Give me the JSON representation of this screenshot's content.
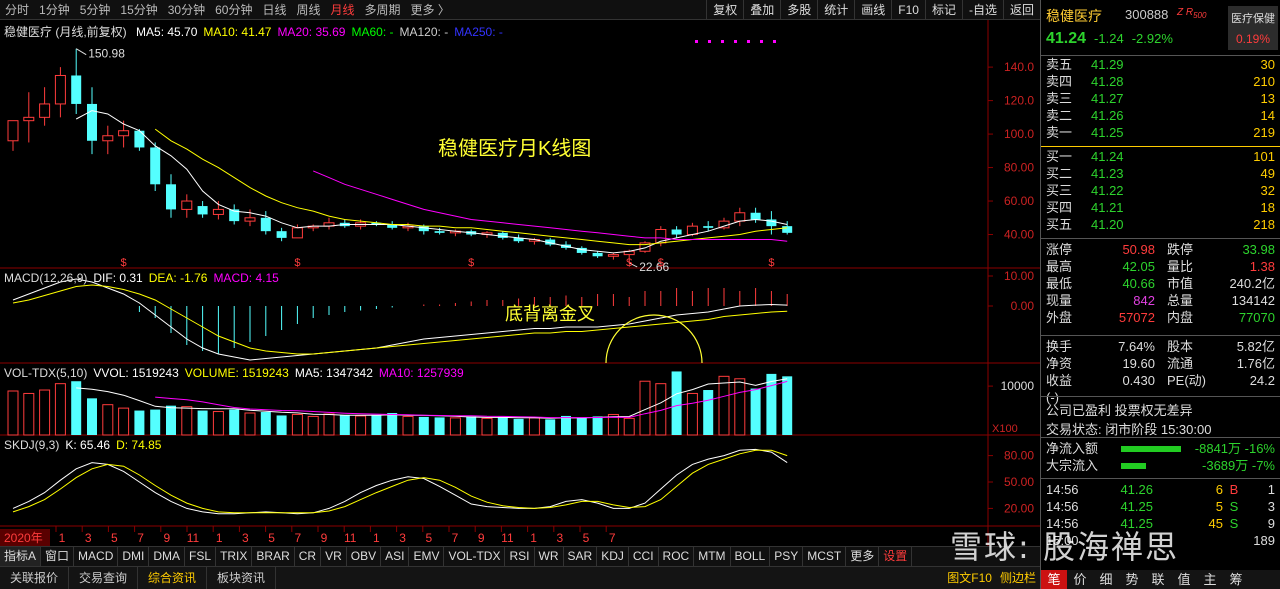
{
  "toolbar": {
    "periods": [
      "分时",
      "1分钟",
      "5分钟",
      "15分钟",
      "30分钟",
      "60分钟",
      "日线",
      "周线",
      "月线",
      "多周期",
      "更多 〉"
    ],
    "active_period": 8,
    "tools": [
      "复权",
      "叠加",
      "多股",
      "统计",
      "画线",
      "F10",
      "标记",
      "-自选",
      "返回"
    ]
  },
  "main_panel": {
    "legend": {
      "title": "稳健医疗 (月线,前复权)",
      "items": [
        {
          "text": "MA5: 45.70",
          "color": "#ffffff"
        },
        {
          "text": "MA10: 41.47",
          "color": "#ffff00"
        },
        {
          "text": "MA20: 35.69",
          "color": "#ff00ff"
        },
        {
          "text": "MA60: -",
          "color": "#00ff00"
        },
        {
          "text": "MA120: -",
          "color": "#cccccc"
        },
        {
          "text": "MA250: -",
          "color": "#3333ff"
        }
      ]
    },
    "y_axis": [
      "140.0",
      "120.0",
      "100.0",
      "80.00",
      "60.00",
      "40.00"
    ],
    "high_label": "150.98",
    "low_label": "22.66",
    "annotation": "稳健医疗月K线图",
    "dividend_marker": "$"
  },
  "macd_panel": {
    "legend": [
      {
        "text": "MACD(12,26,9)",
        "color": "#dddddd"
      },
      {
        "text": "DIF: 0.31",
        "color": "#ffffff"
      },
      {
        "text": "DEA: -1.76",
        "color": "#ffff00"
      },
      {
        "text": "MACD: 4.15",
        "color": "#ff00ff"
      }
    ],
    "y_axis": [
      "10.00",
      "0.00"
    ],
    "annotation": "底背离金叉"
  },
  "vol_panel": {
    "legend": [
      {
        "text": "VOL-TDX(5,10)",
        "color": "#dddddd"
      },
      {
        "text": "VVOL: 1519243",
        "color": "#ffffff"
      },
      {
        "text": "VOLUME: 1519243",
        "color": "#ffff00"
      },
      {
        "text": "MA5: 1347342",
        "color": "#ffffff"
      },
      {
        "text": "MA10: 1257939",
        "color": "#ff00ff"
      }
    ],
    "y_axis": [
      "10000"
    ],
    "unit": "X100"
  },
  "skdj_panel": {
    "legend": [
      {
        "text": "SKDJ(9,3)",
        "color": "#dddddd"
      },
      {
        "text": "K: 65.46",
        "color": "#ffffff"
      },
      {
        "text": "D: 74.85",
        "color": "#ffff00"
      }
    ],
    "y_axis": [
      "80.00",
      "50.00",
      "20.00"
    ]
  },
  "x_axis": {
    "year_label": "2020年",
    "months": [
      "1",
      "3",
      "5",
      "7",
      "9",
      "11",
      "1",
      "3",
      "5",
      "7",
      "9",
      "11",
      "1",
      "3",
      "5",
      "7",
      "9",
      "11",
      "1",
      "3",
      "5",
      "7"
    ]
  },
  "indicator_tabs": [
    "指标A",
    "窗口",
    "MACD",
    "DMI",
    "DMA",
    "FSL",
    "TRIX",
    "BRAR",
    "CR",
    "VR",
    "OBV",
    "ASI",
    "EMV",
    "VOL-TDX",
    "RSI",
    "WR",
    "SAR",
    "KDJ",
    "CCI",
    "ROC",
    "MTM",
    "BOLL",
    "PSY",
    "MCST",
    "更多",
    "设置"
  ],
  "bottom_tabs": [
    "关联报价",
    "交易查询",
    "综合资讯",
    "板块资讯"
  ],
  "bottom_right": [
    "图文F10",
    "侧边栏"
  ],
  "quote": {
    "name": "稳健医疗",
    "code": "300888",
    "tag": "Z R",
    "tag_small": "500",
    "sector_name": "医疗保健",
    "sector_change": "0.19%",
    "price": "41.24",
    "change": "-1.24",
    "change_pct": "-2.92%",
    "asks": [
      {
        "label": "卖五",
        "price": "41.29",
        "vol": "30"
      },
      {
        "label": "卖四",
        "price": "41.28",
        "vol": "210"
      },
      {
        "label": "卖三",
        "price": "41.27",
        "vol": "13"
      },
      {
        "label": "卖二",
        "price": "41.26",
        "vol": "14"
      },
      {
        "label": "卖一",
        "price": "41.25",
        "vol": "219"
      }
    ],
    "bids": [
      {
        "label": "买一",
        "price": "41.24",
        "vol": "101"
      },
      {
        "label": "买二",
        "price": "41.23",
        "vol": "49"
      },
      {
        "label": "买三",
        "price": "41.22",
        "vol": "32"
      },
      {
        "label": "买四",
        "price": "41.21",
        "vol": "18"
      },
      {
        "label": "买五",
        "price": "41.20",
        "vol": "218"
      }
    ],
    "stats1": [
      {
        "a": "涨停",
        "av": "50.98",
        "ac": "red",
        "b": "跌停",
        "bv": "33.98",
        "bc": "green"
      },
      {
        "a": "最高",
        "av": "42.05",
        "ac": "green",
        "b": "量比",
        "bv": "1.38",
        "bc": "red"
      },
      {
        "a": "最低",
        "av": "40.66",
        "ac": "green",
        "b": "市值",
        "bv": "240.2亿",
        "bc": "white"
      },
      {
        "a": "现量",
        "av": "842",
        "ac": "magenta",
        "b": "总量",
        "bv": "134142",
        "bc": "white"
      },
      {
        "a": "外盘",
        "av": "57072",
        "ac": "red",
        "b": "内盘",
        "bv": "77070",
        "bc": "green"
      }
    ],
    "stats2": [
      {
        "a": "换手",
        "av": "7.64%",
        "ac": "white",
        "b": "股本",
        "bv": "5.82亿",
        "bc": "white"
      },
      {
        "a": "净资",
        "av": "19.60",
        "ac": "white",
        "b": "流通",
        "bv": "1.76亿",
        "bc": "white"
      },
      {
        "a": "收益(-)",
        "av": "0.430",
        "ac": "white",
        "b": "PE(动)",
        "bv": "24.2",
        "bc": "white"
      }
    ],
    "note1": "公司已盈利 投票权无差异",
    "note2": "交易状态: 闭市阶段 15:30:00",
    "flows": [
      {
        "label": "净流入额",
        "value": "-8841万 -16%",
        "bar_pct": 1.0
      },
      {
        "label": "大宗流入",
        "value": "-3689万 -7%",
        "bar_pct": 0.42
      }
    ],
    "ticks": [
      {
        "t": "14:56",
        "p": "41.26",
        "v": "6",
        "d": "B",
        "dc": "red",
        "n": "1"
      },
      {
        "t": "14:56",
        "p": "41.25",
        "v": "5",
        "d": "S",
        "dc": "green",
        "n": "3"
      },
      {
        "t": "14:56",
        "p": "41.25",
        "v": "45",
        "d": "S",
        "dc": "green",
        "n": "9"
      },
      {
        "t": "15:00",
        "p": "",
        "v": "",
        "d": "",
        "dc": "green",
        "n": "189"
      }
    ],
    "tabs": [
      "笔",
      "价",
      "细",
      "势",
      "联",
      "值",
      "主",
      "筹"
    ],
    "active_tab": 0
  },
  "watermark": "雪球: 股海禅思",
  "chart_data": {
    "type": "candlestick",
    "x_label": "month",
    "candles": [
      {
        "o": 96,
        "h": 104,
        "l": 90,
        "c": 108
      },
      {
        "o": 108,
        "h": 125,
        "l": 95,
        "c": 110
      },
      {
        "o": 110,
        "h": 128,
        "l": 105,
        "c": 118
      },
      {
        "o": 118,
        "h": 140,
        "l": 110,
        "c": 135
      },
      {
        "o": 135,
        "h": 151,
        "l": 112,
        "c": 118
      },
      {
        "o": 118,
        "h": 128,
        "l": 88,
        "c": 96
      },
      {
        "o": 96,
        "h": 105,
        "l": 88,
        "c": 99
      },
      {
        "o": 99,
        "h": 108,
        "l": 92,
        "c": 102
      },
      {
        "o": 102,
        "h": 103,
        "l": 90,
        "c": 92
      },
      {
        "o": 92,
        "h": 95,
        "l": 66,
        "c": 70
      },
      {
        "o": 70,
        "h": 76,
        "l": 50,
        "c": 55
      },
      {
        "o": 55,
        "h": 64,
        "l": 50,
        "c": 60
      },
      {
        "o": 57,
        "h": 60,
        "l": 50,
        "c": 52
      },
      {
        "o": 52,
        "h": 60,
        "l": 49,
        "c": 55
      },
      {
        "o": 55,
        "h": 58,
        "l": 46,
        "c": 48
      },
      {
        "o": 48,
        "h": 55,
        "l": 45,
        "c": 50
      },
      {
        "o": 50,
        "h": 54,
        "l": 40,
        "c": 42
      },
      {
        "o": 42,
        "h": 44,
        "l": 36,
        "c": 38
      },
      {
        "o": 38,
        "h": 46,
        "l": 38,
        "c": 44
      },
      {
        "o": 44,
        "h": 46,
        "l": 42,
        "c": 45
      },
      {
        "o": 45,
        "h": 50,
        "l": 43,
        "c": 47
      },
      {
        "o": 47,
        "h": 49,
        "l": 44,
        "c": 45
      },
      {
        "o": 45,
        "h": 49,
        "l": 43,
        "c": 47
      },
      {
        "o": 47,
        "h": 48,
        "l": 45,
        "c": 46
      },
      {
        "o": 46,
        "h": 48,
        "l": 43,
        "c": 44
      },
      {
        "o": 44,
        "h": 47,
        "l": 42,
        "c": 45
      },
      {
        "o": 45,
        "h": 46,
        "l": 40,
        "c": 42
      },
      {
        "o": 42,
        "h": 44,
        "l": 40,
        "c": 41
      },
      {
        "o": 41,
        "h": 43,
        "l": 39,
        "c": 42
      },
      {
        "o": 42,
        "h": 43,
        "l": 39,
        "c": 40
      },
      {
        "o": 40,
        "h": 42,
        "l": 38,
        "c": 41
      },
      {
        "o": 41,
        "h": 42,
        "l": 37,
        "c": 38
      },
      {
        "o": 38,
        "h": 40,
        "l": 35,
        "c": 36
      },
      {
        "o": 36,
        "h": 38,
        "l": 34,
        "c": 37
      },
      {
        "o": 37,
        "h": 38,
        "l": 33,
        "c": 34
      },
      {
        "o": 34,
        "h": 36,
        "l": 31,
        "c": 32
      },
      {
        "o": 32,
        "h": 33,
        "l": 28,
        "c": 29
      },
      {
        "o": 29,
        "h": 30,
        "l": 26,
        "c": 27
      },
      {
        "o": 27,
        "h": 29,
        "l": 25,
        "c": 28
      },
      {
        "o": 28,
        "h": 31,
        "l": 23,
        "c": 30
      },
      {
        "o": 30,
        "h": 36,
        "l": 29,
        "c": 35
      },
      {
        "o": 35,
        "h": 45,
        "l": 33,
        "c": 43
      },
      {
        "o": 43,
        "h": 45,
        "l": 38,
        "c": 40
      },
      {
        "o": 40,
        "h": 47,
        "l": 39,
        "c": 45
      },
      {
        "o": 45,
        "h": 48,
        "l": 42,
        "c": 44
      },
      {
        "o": 44,
        "h": 50,
        "l": 43,
        "c": 48
      },
      {
        "o": 48,
        "h": 56,
        "l": 45,
        "c": 53
      },
      {
        "o": 53,
        "h": 56,
        "l": 47,
        "c": 49
      },
      {
        "o": 49,
        "h": 54,
        "l": 40,
        "c": 45
      },
      {
        "o": 45,
        "h": 48,
        "l": 40,
        "c": 41
      }
    ],
    "ma10": [
      null,
      null,
      null,
      null,
      null,
      null,
      null,
      null,
      null,
      103,
      96,
      91,
      85,
      80,
      74,
      68,
      63,
      59,
      56,
      54,
      51,
      49,
      48,
      47,
      46,
      46,
      45,
      45,
      44,
      44,
      43,
      42,
      41,
      40,
      39,
      38,
      37,
      36,
      35,
      34,
      34,
      35,
      36,
      37,
      38,
      39,
      40,
      42,
      43,
      44
    ],
    "ma5": [
      null,
      null,
      null,
      null,
      109,
      114,
      112,
      106,
      102,
      93,
      87,
      79,
      66,
      58,
      54,
      53,
      51,
      47,
      44,
      45,
      45,
      46,
      46,
      46,
      46,
      45,
      44,
      43,
      42,
      41,
      40,
      39,
      38,
      37,
      35,
      33,
      31,
      30,
      29,
      30,
      32,
      36,
      38,
      40,
      42,
      45,
      48,
      49,
      48,
      46
    ],
    "ma20": [
      null,
      null,
      null,
      null,
      null,
      null,
      null,
      null,
      null,
      null,
      null,
      null,
      null,
      null,
      null,
      null,
      null,
      null,
      null,
      78,
      74,
      70,
      67,
      64,
      61,
      58,
      55,
      53,
      51,
      49,
      48,
      47,
      46,
      45,
      44,
      43,
      42,
      41,
      40,
      39,
      38,
      38,
      37,
      37,
      37,
      37,
      37,
      37,
      37,
      36
    ],
    "volume": [
      9000,
      8500,
      9200,
      10500,
      11000,
      7500,
      6200,
      5500,
      5000,
      5200,
      6000,
      5800,
      5000,
      4800,
      5200,
      4500,
      4700,
      4000,
      4200,
      3800,
      4300,
      4000,
      3900,
      4100,
      4500,
      3800,
      3700,
      3600,
      3500,
      3800,
      3400,
      3700,
      3300,
      3500,
      3200,
      3900,
      3600,
      3800,
      4200,
      3400,
      11000,
      10500,
      13000,
      8500,
      9200,
      12000,
      11500,
      9500,
      12500,
      12000
    ],
    "macd_hist": [
      0,
      0,
      0,
      0,
      0,
      0,
      0,
      0,
      -2,
      -4,
      -9,
      -13,
      -15,
      -16,
      -14,
      -12,
      -10,
      -8,
      -6,
      -4,
      -3,
      -2,
      -1.5,
      -1,
      -0.5,
      0,
      0.5,
      0.5,
      1,
      1.5,
      2,
      2,
      2.5,
      3,
      3,
      3.5,
      3,
      4,
      4,
      3,
      5,
      5,
      6,
      5,
      6,
      6,
      5,
      6,
      5,
      4
    ],
    "dif": [
      2,
      4,
      6,
      8,
      9,
      8,
      6,
      4,
      1,
      -3,
      -7,
      -11,
      -14,
      -16,
      -17,
      -18,
      -17.5,
      -17,
      -16.5,
      -16,
      -15.5,
      -15,
      -14.5,
      -14,
      -13,
      -12,
      -11,
      -10.5,
      -10,
      -9.5,
      -9,
      -8.5,
      -8,
      -7.5,
      -7.5,
      -7,
      -7,
      -7,
      -6.5,
      -6,
      -5,
      -4,
      -3,
      -2.5,
      -2,
      -1,
      0,
      0.3,
      0.5,
      0.31
    ],
    "dea": [
      1,
      2,
      3.5,
      5,
      6.5,
      7,
      6.5,
      5.5,
      4,
      2,
      -1,
      -4,
      -7,
      -10,
      -12,
      -14,
      -15,
      -15.5,
      -16,
      -16,
      -15.5,
      -15,
      -14.5,
      -14,
      -13.5,
      -13,
      -12.5,
      -12,
      -11.5,
      -11,
      -10.5,
      -10,
      -9.5,
      -9,
      -9,
      -8.5,
      -8.5,
      -8,
      -7.5,
      -7,
      -6.5,
      -6,
      -5.5,
      -5,
      -4.5,
      -3.5,
      -3,
      -2.5,
      -2,
      -1.76
    ],
    "skdj_k": [
      20,
      28,
      38,
      52,
      65,
      72,
      70,
      62,
      50,
      38,
      28,
      20,
      16,
      14,
      14,
      15,
      16,
      15,
      14,
      15,
      20,
      28,
      38,
      46,
      52,
      56,
      54,
      45,
      35,
      25,
      22,
      21,
      20,
      20,
      22,
      28,
      30,
      26,
      20,
      20,
      26,
      42,
      58,
      70,
      76,
      80,
      86,
      87,
      84,
      72
    ],
    "skdj_d": [
      16,
      22,
      30,
      42,
      55,
      65,
      70,
      68,
      58,
      46,
      35,
      26,
      20,
      16,
      15,
      15,
      15,
      15,
      15,
      15,
      17,
      22,
      30,
      38,
      45,
      52,
      55,
      52,
      44,
      34,
      27,
      23,
      21,
      20,
      21,
      24,
      28,
      28,
      24,
      21,
      22,
      30,
      45,
      60,
      70,
      76,
      82,
      86,
      86,
      80
    ]
  }
}
